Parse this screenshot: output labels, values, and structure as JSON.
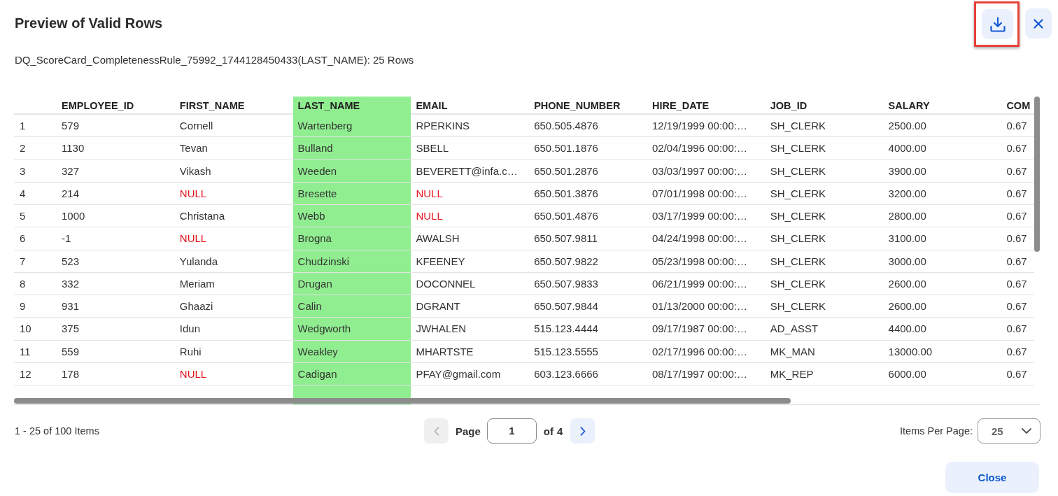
{
  "dialog": {
    "title": "Preview of Valid Rows",
    "download_button": {
      "highlighted": true
    },
    "subtitle": "DQ_ScoreCard_CompletenessRule_75992_1744128450433(LAST_NAME): 25 Rows"
  },
  "table": {
    "columns": [
      {
        "label": "EMPLOYEE_ID",
        "highlighted": false
      },
      {
        "label": "FIRST_NAME",
        "highlighted": false
      },
      {
        "label": "LAST_NAME",
        "highlighted": true
      },
      {
        "label": "EMAIL",
        "highlighted": false
      },
      {
        "label": "PHONE_NUMBER",
        "highlighted": false
      },
      {
        "label": "HIRE_DATE",
        "highlighted": false
      },
      {
        "label": "JOB_ID",
        "highlighted": false
      },
      {
        "label": "SALARY",
        "highlighted": false
      },
      {
        "label": "COM",
        "highlighted": false
      }
    ],
    "rows": [
      {
        "number": "1",
        "cells": [
          {
            "text": "579",
            "is_null": false
          },
          {
            "text": "Cornell",
            "is_null": false
          },
          {
            "text": "Wartenberg",
            "is_null": false
          },
          {
            "text": "RPERKINS",
            "is_null": false
          },
          {
            "text": "650.505.4876",
            "is_null": false
          },
          {
            "text": "12/19/1999 00:00:…",
            "is_null": false
          },
          {
            "text": "SH_CLERK",
            "is_null": false
          },
          {
            "text": "2500.00",
            "is_null": false
          },
          {
            "text": "0.67",
            "is_null": false
          }
        ]
      },
      {
        "number": "2",
        "cells": [
          {
            "text": "1130",
            "is_null": false
          },
          {
            "text": "Tevan",
            "is_null": false
          },
          {
            "text": "Bulland",
            "is_null": false
          },
          {
            "text": "SBELL",
            "is_null": false
          },
          {
            "text": "650.501.1876",
            "is_null": false
          },
          {
            "text": "02/04/1996 00:00:…",
            "is_null": false
          },
          {
            "text": "SH_CLERK",
            "is_null": false
          },
          {
            "text": "4000.00",
            "is_null": false
          },
          {
            "text": "0.67",
            "is_null": false
          }
        ]
      },
      {
        "number": "3",
        "cells": [
          {
            "text": "327",
            "is_null": false
          },
          {
            "text": "Vikash",
            "is_null": false
          },
          {
            "text": "Weeden",
            "is_null": false
          },
          {
            "text": "BEVERETT@infa.c…",
            "is_null": false
          },
          {
            "text": "650.501.2876",
            "is_null": false
          },
          {
            "text": "03/03/1997 00:00:…",
            "is_null": false
          },
          {
            "text": "SH_CLERK",
            "is_null": false
          },
          {
            "text": "3900.00",
            "is_null": false
          },
          {
            "text": "0.67",
            "is_null": false
          }
        ]
      },
      {
        "number": "4",
        "cells": [
          {
            "text": "214",
            "is_null": false
          },
          {
            "text": "NULL",
            "is_null": true
          },
          {
            "text": "Bresette",
            "is_null": false
          },
          {
            "text": "NULL",
            "is_null": true
          },
          {
            "text": "650.501.3876",
            "is_null": false
          },
          {
            "text": "07/01/1998 00:00:…",
            "is_null": false
          },
          {
            "text": "SH_CLERK",
            "is_null": false
          },
          {
            "text": "3200.00",
            "is_null": false
          },
          {
            "text": "0.67",
            "is_null": false
          }
        ]
      },
      {
        "number": "5",
        "cells": [
          {
            "text": "1000",
            "is_null": false
          },
          {
            "text": "Christana",
            "is_null": false
          },
          {
            "text": "Webb",
            "is_null": false
          },
          {
            "text": "NULL",
            "is_null": true
          },
          {
            "text": "650.501.4876",
            "is_null": false
          },
          {
            "text": "03/17/1999 00:00:…",
            "is_null": false
          },
          {
            "text": "SH_CLERK",
            "is_null": false
          },
          {
            "text": "2800.00",
            "is_null": false
          },
          {
            "text": "0.67",
            "is_null": false
          }
        ]
      },
      {
        "number": "6",
        "cells": [
          {
            "text": "-1",
            "is_null": false
          },
          {
            "text": "NULL",
            "is_null": true
          },
          {
            "text": "Brogna",
            "is_null": false
          },
          {
            "text": "AWALSH",
            "is_null": false
          },
          {
            "text": "650.507.9811",
            "is_null": false
          },
          {
            "text": "04/24/1998 00:00:…",
            "is_null": false
          },
          {
            "text": "SH_CLERK",
            "is_null": false
          },
          {
            "text": "3100.00",
            "is_null": false
          },
          {
            "text": "0.67",
            "is_null": false
          }
        ]
      },
      {
        "number": "7",
        "cells": [
          {
            "text": "523",
            "is_null": false
          },
          {
            "text": "Yulanda",
            "is_null": false
          },
          {
            "text": "Chudzinski",
            "is_null": false
          },
          {
            "text": "KFEENEY",
            "is_null": false
          },
          {
            "text": "650.507.9822",
            "is_null": false
          },
          {
            "text": "05/23/1998 00:00:…",
            "is_null": false
          },
          {
            "text": "SH_CLERK",
            "is_null": false
          },
          {
            "text": "3000.00",
            "is_null": false
          },
          {
            "text": "0.67",
            "is_null": false
          }
        ]
      },
      {
        "number": "8",
        "cells": [
          {
            "text": "332",
            "is_null": false
          },
          {
            "text": "Meriam",
            "is_null": false
          },
          {
            "text": "Drugan",
            "is_null": false
          },
          {
            "text": "DOCONNEL",
            "is_null": false
          },
          {
            "text": "650.507.9833",
            "is_null": false
          },
          {
            "text": "06/21/1999 00:00:…",
            "is_null": false
          },
          {
            "text": "SH_CLERK",
            "is_null": false
          },
          {
            "text": "2600.00",
            "is_null": false
          },
          {
            "text": "0.67",
            "is_null": false
          }
        ]
      },
      {
        "number": "9",
        "cells": [
          {
            "text": "931",
            "is_null": false
          },
          {
            "text": "Ghaazi",
            "is_null": false
          },
          {
            "text": "Calin",
            "is_null": false
          },
          {
            "text": "DGRANT",
            "is_null": false
          },
          {
            "text": "650.507.9844",
            "is_null": false
          },
          {
            "text": "01/13/2000 00:00:…",
            "is_null": false
          },
          {
            "text": "SH_CLERK",
            "is_null": false
          },
          {
            "text": "2600.00",
            "is_null": false
          },
          {
            "text": "0.67",
            "is_null": false
          }
        ]
      },
      {
        "number": "10",
        "cells": [
          {
            "text": "375",
            "is_null": false
          },
          {
            "text": "Idun",
            "is_null": false
          },
          {
            "text": "Wedgworth",
            "is_null": false
          },
          {
            "text": "JWHALEN",
            "is_null": false
          },
          {
            "text": "515.123.4444",
            "is_null": false
          },
          {
            "text": "09/17/1987 00:00:…",
            "is_null": false
          },
          {
            "text": "AD_ASST",
            "is_null": false
          },
          {
            "text": "4400.00",
            "is_null": false
          },
          {
            "text": "0.67",
            "is_null": false
          }
        ]
      },
      {
        "number": "11",
        "cells": [
          {
            "text": "559",
            "is_null": false
          },
          {
            "text": "Ruhi",
            "is_null": false
          },
          {
            "text": "Weakley",
            "is_null": false
          },
          {
            "text": "MHARTSTE",
            "is_null": false
          },
          {
            "text": "515.123.5555",
            "is_null": false
          },
          {
            "text": "02/17/1996 00:00:…",
            "is_null": false
          },
          {
            "text": "MK_MAN",
            "is_null": false
          },
          {
            "text": "13000.00",
            "is_null": false
          },
          {
            "text": "0.67",
            "is_null": false
          }
        ]
      },
      {
        "number": "12",
        "cells": [
          {
            "text": "178",
            "is_null": false
          },
          {
            "text": "NULL",
            "is_null": true
          },
          {
            "text": "Cadigan",
            "is_null": false
          },
          {
            "text": "PFAY@gmail.com",
            "is_null": false
          },
          {
            "text": "603.123.6666",
            "is_null": false
          },
          {
            "text": "08/17/1997 00:00:…",
            "is_null": false
          },
          {
            "text": "MK_REP",
            "is_null": false
          },
          {
            "text": "6000.00",
            "is_null": false
          },
          {
            "text": "0.67",
            "is_null": false
          }
        ]
      }
    ]
  },
  "footer": {
    "range": "1 - 25 of 100 Items",
    "pagination": {
      "previous": {
        "disabled": true
      },
      "page_label": "Page",
      "page_value": "1",
      "of_label": "of",
      "page_count": "4",
      "next": {
        "disabled": false
      }
    },
    "items_per_page": {
      "label": "Items Per Page:",
      "value": "25"
    }
  },
  "buttons": [
    {
      "label": "Close"
    }
  ]
}
